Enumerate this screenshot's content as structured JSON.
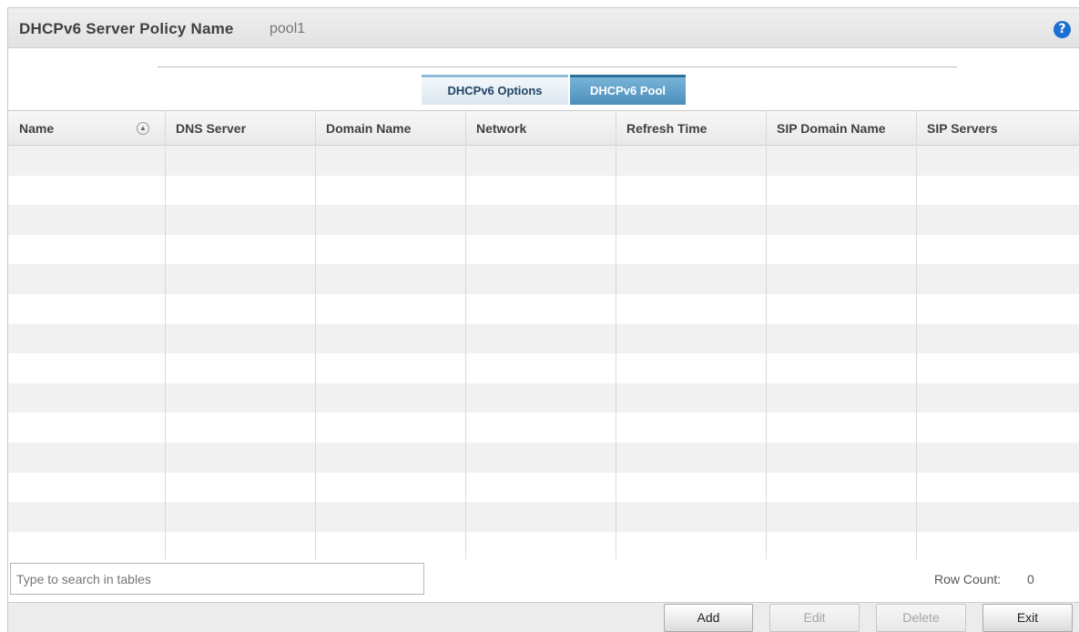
{
  "header": {
    "title": "DHCPv6 Server Policy Name",
    "policy_name": "pool1",
    "help_icon": "help-icon"
  },
  "tabs": [
    {
      "label": "DHCPv6 Options",
      "active": false
    },
    {
      "label": "DHCPv6 Pool",
      "active": true
    }
  ],
  "table": {
    "columns": [
      "Name",
      "DNS Server",
      "Domain Name",
      "Network",
      "Refresh Time",
      "SIP Domain Name",
      "SIP Servers"
    ],
    "sorted_column": "Name",
    "rows": []
  },
  "search": {
    "placeholder": "Type to search in tables"
  },
  "row_count": {
    "label": "Row Count:",
    "value": "0"
  },
  "buttons": {
    "add": "Add",
    "edit": "Edit",
    "delete": "Delete",
    "exit": "Exit"
  },
  "colors": {
    "active_tab": "#4c8fbc",
    "help_icon": "#1a6fd0"
  }
}
